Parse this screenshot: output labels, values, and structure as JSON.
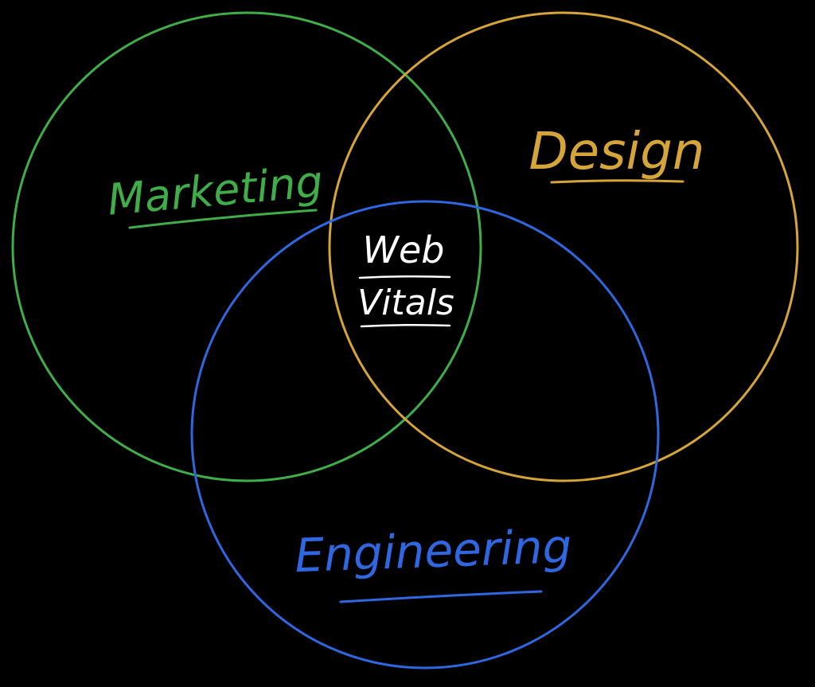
{
  "colors": {
    "background": "#000000",
    "marketing": "#3fae49",
    "design": "#d6a53a",
    "engineering": "#2f67e0",
    "center": "#ffffff"
  },
  "circles": [
    {
      "id": "marketing",
      "label": "Marketing",
      "color": "#3fae49"
    },
    {
      "id": "design",
      "label": "Design",
      "color": "#d6a53a"
    },
    {
      "id": "engineering",
      "label": "Engineering",
      "color": "#2f67e0"
    }
  ],
  "center": {
    "line1": "Web",
    "line2": "Vitals"
  }
}
